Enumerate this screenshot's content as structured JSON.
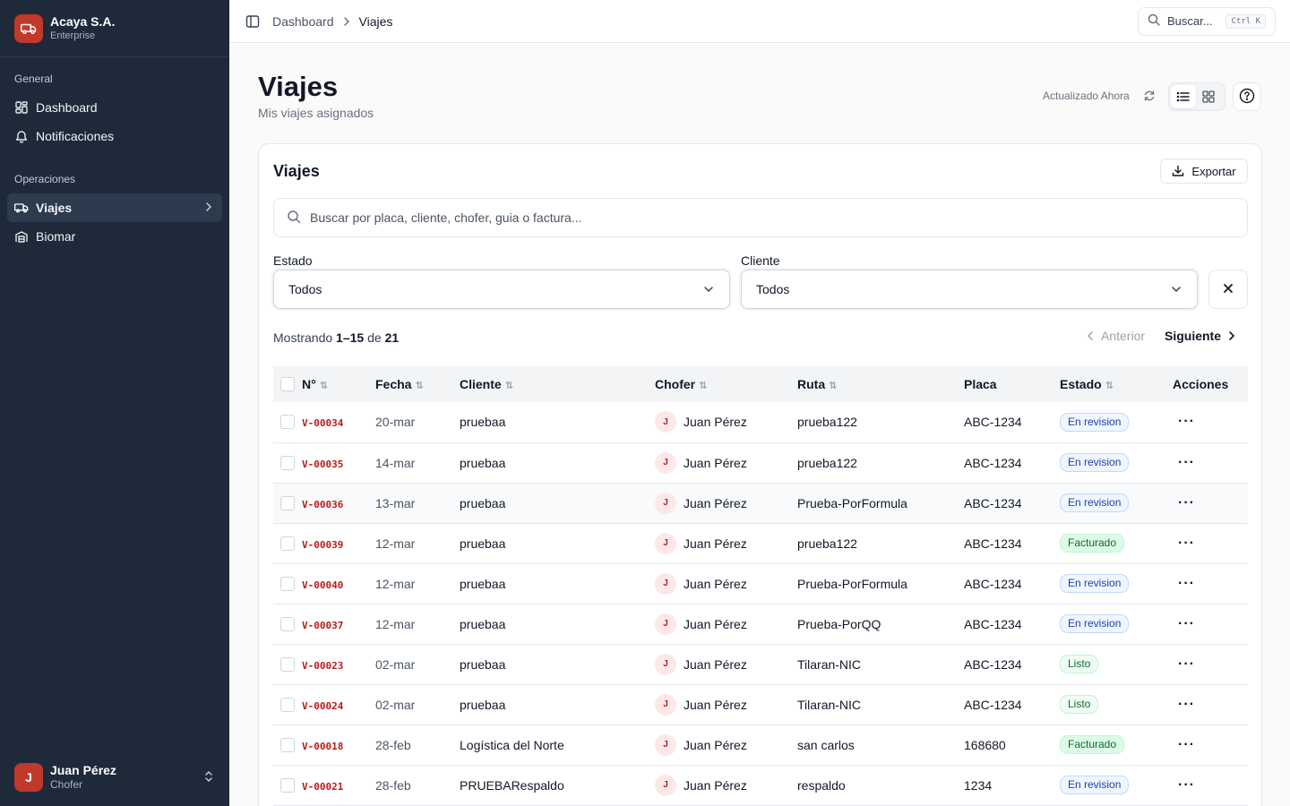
{
  "colors": {
    "sidebar_bg": "#1e2a3a",
    "accent": "#c0392b",
    "id_red": "#b91c1c"
  },
  "company": {
    "name": "Acaya S.A.",
    "plan": "Enterprise",
    "logo_icon": "truck-icon"
  },
  "sidebar": {
    "sections": [
      {
        "title": "General",
        "items": [
          {
            "label": "Dashboard",
            "icon": "grid-icon"
          },
          {
            "label": "Notificaciones",
            "icon": "bell-icon"
          }
        ]
      },
      {
        "title": "Operaciones",
        "items": [
          {
            "label": "Viajes",
            "icon": "truck-icon",
            "active": true
          },
          {
            "label": "Biomar",
            "icon": "warehouse-icon"
          }
        ]
      }
    ]
  },
  "user": {
    "initial": "J",
    "name": "Juan Pérez",
    "role": "Chofer"
  },
  "breadcrumb": [
    "Dashboard",
    "Viajes"
  ],
  "top_search": {
    "label": "Buscar...",
    "shortcut": "Ctrl K"
  },
  "page": {
    "title": "Viajes",
    "subtitle": "Mis viajes asignados",
    "updated": "Actualizado Ahora"
  },
  "card": {
    "title": "Viajes",
    "export_label": "Exportar",
    "search_placeholder": "Buscar por placa, cliente, chofer, guia o factura...",
    "filters": {
      "estado": {
        "label": "Estado",
        "value": "Todos"
      },
      "cliente": {
        "label": "Cliente",
        "value": "Todos"
      }
    },
    "showing": {
      "prefix": "Mostrando",
      "range": "1–15",
      "of": "de",
      "total": "21"
    },
    "pager": {
      "prev": "Anterior",
      "next": "Siguiente"
    }
  },
  "table": {
    "columns": [
      "N°",
      "Fecha",
      "Cliente",
      "Chofer",
      "Ruta",
      "Placa",
      "Estado",
      "Acciones"
    ],
    "rows": [
      {
        "id": "V-00034",
        "fecha": "20-mar",
        "cliente": "pruebaa",
        "chofer_initial": "J",
        "chofer": "Juan Pérez",
        "ruta": "prueba122",
        "placa": "ABC-1234",
        "estado": "En revision",
        "tipo": "rev"
      },
      {
        "id": "V-00035",
        "fecha": "14-mar",
        "cliente": "pruebaa",
        "chofer_initial": "J",
        "chofer": "Juan Pérez",
        "ruta": "prueba122",
        "placa": "ABC-1234",
        "estado": "En revision",
        "tipo": "rev"
      },
      {
        "id": "V-00036",
        "fecha": "13-mar",
        "cliente": "pruebaa",
        "chofer_initial": "J",
        "chofer": "Juan Pérez",
        "ruta": "Prueba-PorFormula",
        "placa": "ABC-1234",
        "estado": "En revision",
        "tipo": "rev"
      },
      {
        "id": "V-00039",
        "fecha": "12-mar",
        "cliente": "pruebaa",
        "chofer_initial": "J",
        "chofer": "Juan Pérez",
        "ruta": "prueba122",
        "placa": "ABC-1234",
        "estado": "Facturado",
        "tipo": "fac"
      },
      {
        "id": "V-00040",
        "fecha": "12-mar",
        "cliente": "pruebaa",
        "chofer_initial": "J",
        "chofer": "Juan Pérez",
        "ruta": "Prueba-PorFormula",
        "placa": "ABC-1234",
        "estado": "En revision",
        "tipo": "rev"
      },
      {
        "id": "V-00037",
        "fecha": "12-mar",
        "cliente": "pruebaa",
        "chofer_initial": "J",
        "chofer": "Juan Pérez",
        "ruta": "Prueba-PorQQ",
        "placa": "ABC-1234",
        "estado": "En revision",
        "tipo": "rev"
      },
      {
        "id": "V-00023",
        "fecha": "02-mar",
        "cliente": "pruebaa",
        "chofer_initial": "J",
        "chofer": "Juan Pérez",
        "ruta": "Tilaran-NIC",
        "placa": "ABC-1234",
        "estado": "Listo",
        "tipo": "lis"
      },
      {
        "id": "V-00024",
        "fecha": "02-mar",
        "cliente": "pruebaa",
        "chofer_initial": "J",
        "chofer": "Juan Pérez",
        "ruta": "Tilaran-NIC",
        "placa": "ABC-1234",
        "estado": "Listo",
        "tipo": "lis"
      },
      {
        "id": "V-00018",
        "fecha": "28-feb",
        "cliente": "Logística del Norte",
        "chofer_initial": "J",
        "chofer": "Juan Pérez",
        "ruta": "san carlos",
        "placa": "168680",
        "estado": "Facturado",
        "tipo": "fac"
      },
      {
        "id": "V-00021",
        "fecha": "28-feb",
        "cliente": "PRUEBARespaldo",
        "chofer_initial": "J",
        "chofer": "Juan Pérez",
        "ruta": "respaldo",
        "placa": "1234",
        "estado": "En revision",
        "tipo": "rev"
      }
    ]
  }
}
